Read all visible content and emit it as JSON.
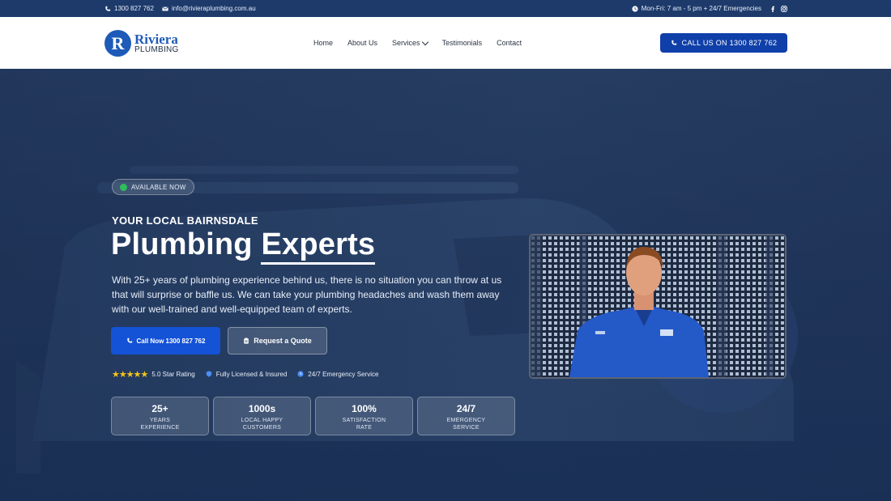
{
  "topbar": {
    "phone": "1300 827 762",
    "email": "info@rivieraplumbing.com.au",
    "hours": "Mon-Fri: 7 am - 5 pm + 24/7 Emergencies"
  },
  "logo": {
    "main": "Riviera",
    "sub": "PLUMBING",
    "initial": "R"
  },
  "nav": {
    "items": [
      "Home",
      "About Us",
      "Services",
      "Testimonials",
      "Contact"
    ],
    "cta": "CALL US ON 1300 827 762"
  },
  "hero": {
    "badge": "AVAILABLE NOW",
    "eyebrow": "YOUR LOCAL BAIRNSDALE",
    "title_a": "Plumbing",
    "title_b": "Experts",
    "lede": "With 25+ years of plumbing experience behind us, there is no situation you can throw at us that will surprise or baffle us. We can take your plumbing headaches and wash them away with our well-trained and well-equipped team of experts.",
    "btn_call": "Call Now 1300 827 762",
    "btn_quote": "Request a Quote",
    "trust": [
      "5.0 Star Rating",
      "Fully Licensed & Insured",
      "24/7 Emergency Service"
    ],
    "rating_stars": 5,
    "stats": [
      {
        "value": "25+",
        "label": "YEARS\nEXPERIENCE"
      },
      {
        "value": "1000s",
        "label": "LOCAL HAPPY\nCUSTOMERS"
      },
      {
        "value": "100%",
        "label": "SATISFACTION\nRATE"
      },
      {
        "value": "24/7",
        "label": "EMERGENCY\nSERVICE"
      }
    ]
  },
  "colors": {
    "brand": "#1e5bb8",
    "cta": "#0f3fa8",
    "topbar": "#1d3a6b",
    "star": "#f5c518",
    "available": "#2fbf5a"
  }
}
